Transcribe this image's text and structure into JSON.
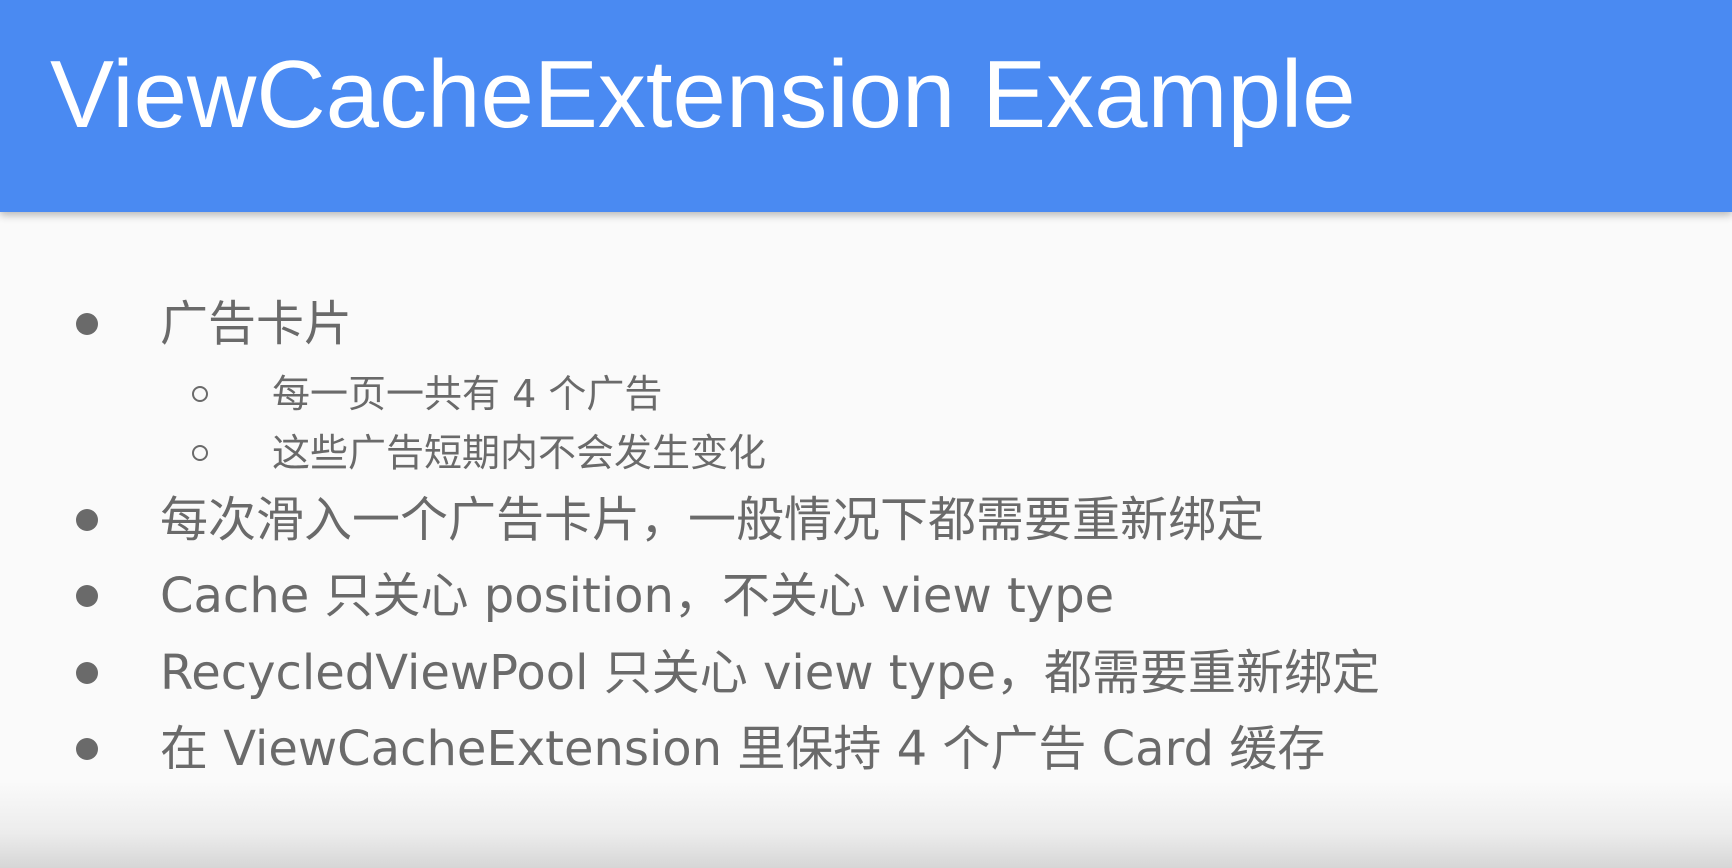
{
  "slide": {
    "title": "ViewCacheExtension Example",
    "colors": {
      "header": "#4a8af2",
      "title_text": "#ffffff",
      "body_text": "#6a6a6a",
      "background": "#fafafa"
    },
    "bullets": [
      {
        "text": "广告卡片",
        "sub": [
          {
            "text": "每一页一共有 4 个广告"
          },
          {
            "text": "这些广告短期内不会发生变化"
          }
        ]
      },
      {
        "text": "每次滑入一个广告卡片，一般情况下都需要重新绑定"
      },
      {
        "text": "Cache 只关心 position，不关心 view type"
      },
      {
        "text": "RecycledViewPool 只关心 view type，都需要重新绑定"
      },
      {
        "text": "在 ViewCacheExtension 里保持 4 个广告 Card 缓存"
      }
    ]
  }
}
